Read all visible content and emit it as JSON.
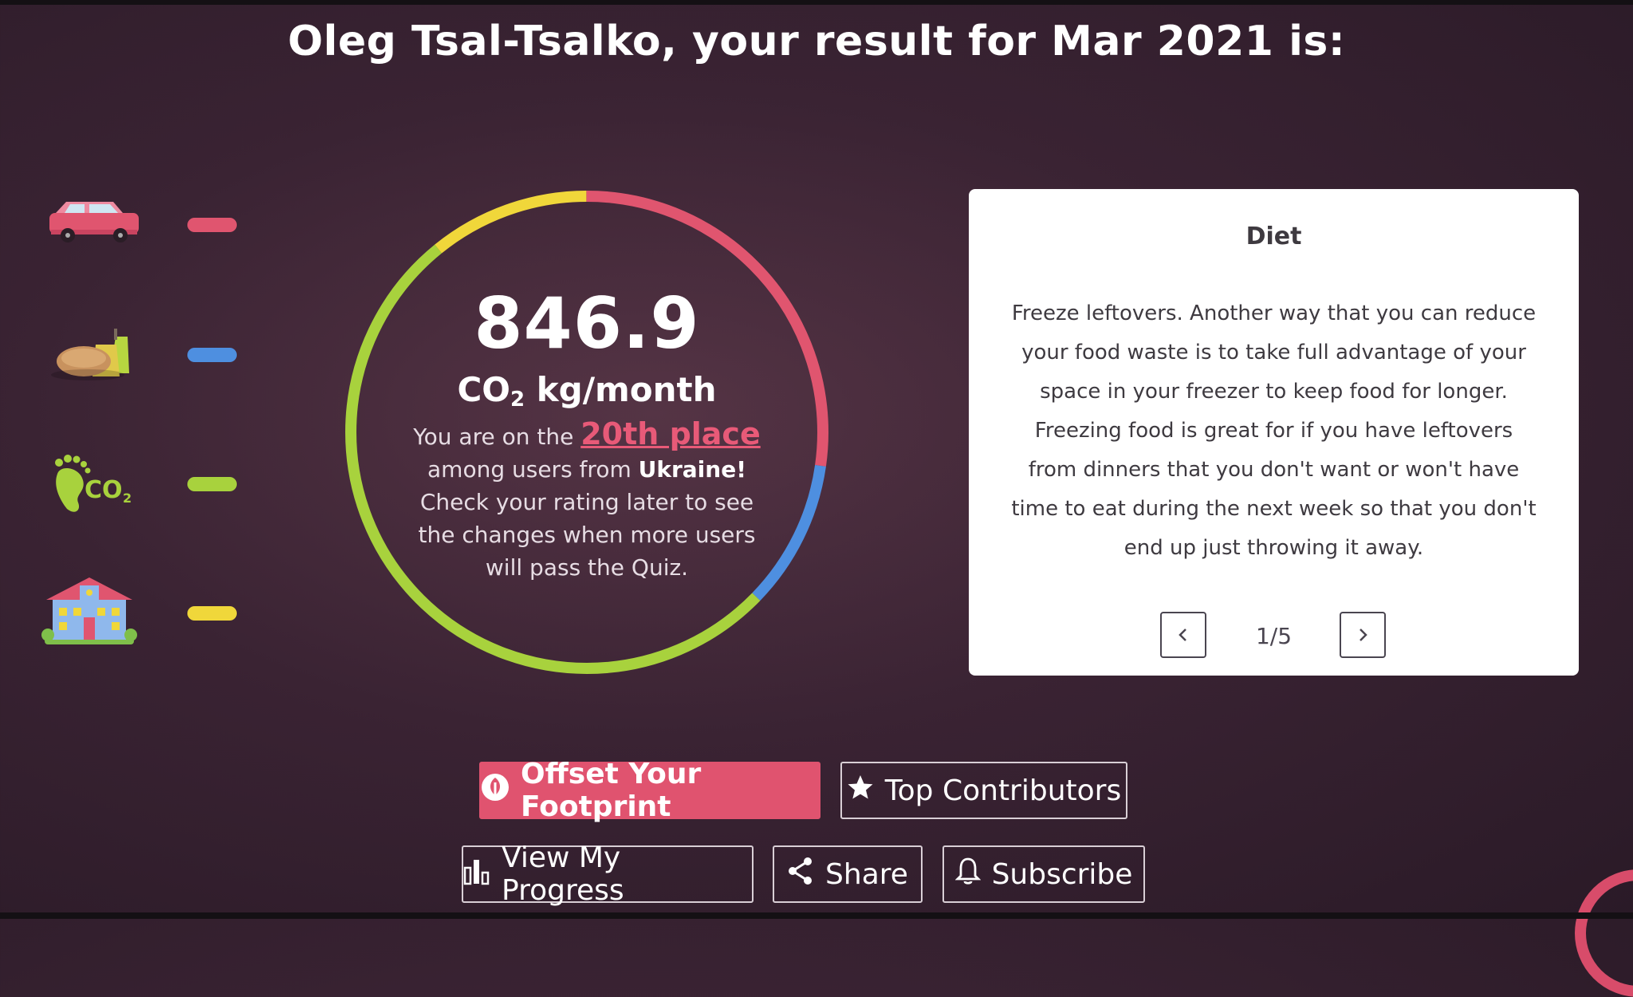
{
  "header": {
    "title": "Oleg Tsal-Tsalko, your result for Mar 2021 is:"
  },
  "categories": [
    {
      "icon": "car-icon",
      "bar_color": "#e0556f"
    },
    {
      "icon": "food-icon",
      "bar_color": "#4e8fe0"
    },
    {
      "icon": "co2-footprint-icon",
      "bar_color": "#a8d23d"
    },
    {
      "icon": "house-icon",
      "bar_color": "#f0d73a"
    }
  ],
  "result": {
    "score": "846.9",
    "unit_prefix": "CO",
    "unit_sub": "2",
    "unit_suffix": " kg/month",
    "rank_prefix": "You are on the ",
    "rank_place": "20th place",
    "rank_among": "among users from ",
    "rank_country": "Ukraine!",
    "rank_note": "Check your rating later to see the changes when more users will pass the Quiz.",
    "ring_colors": {
      "transport": "#e0556f",
      "diet": "#4e8fe0",
      "footprint": "#a8d23d",
      "housing": "#f0d73a"
    }
  },
  "tip_card": {
    "title": "Diet",
    "text": "Freeze leftovers. Another way that you can reduce your food waste is to take full advantage of your space in your freezer to keep food for longer. Freezing food is great for if you have leftovers from dinners that you don't want or won't have time to eat during the next week so that you don't end up just throwing it away.",
    "pager": "1/5"
  },
  "buttons": {
    "offset": "Offset Your Footprint",
    "top_contributors": "Top Contributors",
    "view_progress": "View My Progress",
    "share": "Share",
    "subscribe": "Subscribe"
  }
}
